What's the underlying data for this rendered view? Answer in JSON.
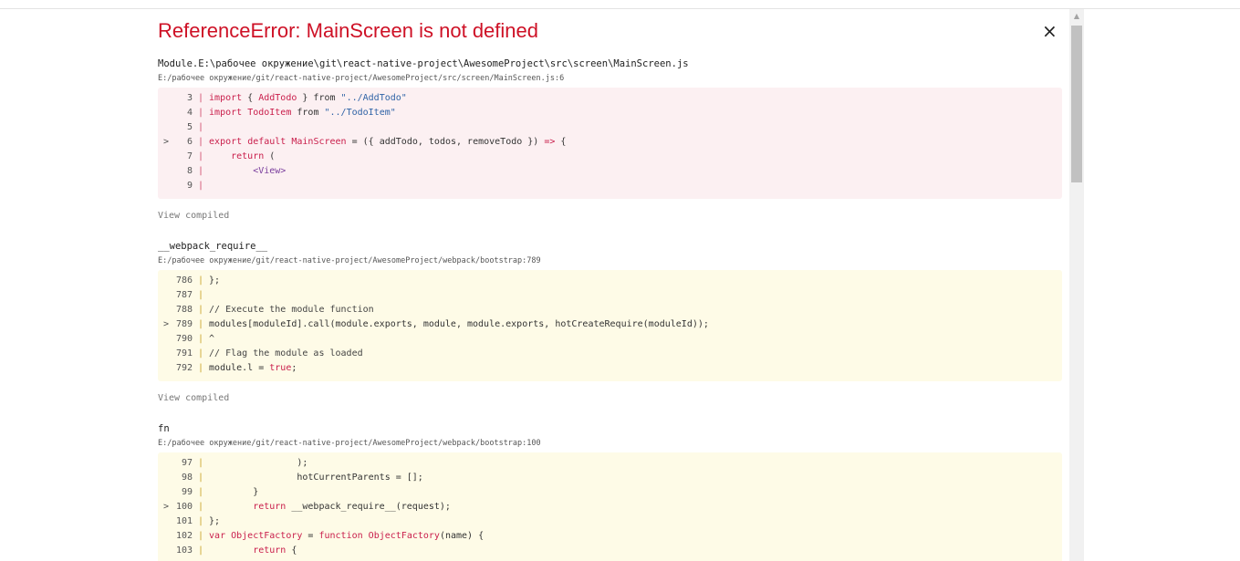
{
  "error": {
    "title": "ReferenceError: MainScreen is not defined",
    "close_glyph": "×"
  },
  "frames": [
    {
      "name": "Module.E:\\рабочее окружение\\git\\react-native-project\\AwesomeProject\\src\\screen\\MainScreen.js",
      "path": "E:/рабочее окружение/git/react-native-project/AwesomeProject/src/screen/MainScreen.js:6",
      "view_compiled": "View compiled"
    },
    {
      "name": "__webpack_require__",
      "path": "E:/рабочее окружение/git/react-native-project/AwesomeProject/webpack/bootstrap:789",
      "view_compiled": "View compiled"
    },
    {
      "name": "fn",
      "path": "E:/рабочее окружение/git/react-native-project/AwesomeProject/webpack/bootstrap:100"
    }
  ],
  "colors": {
    "error_title": "#ce1126",
    "app_code_bg": "#fcf0f2",
    "lib_code_bg": "#fefbe7",
    "keyword": "#c91e4b",
    "string": "#2f63a6"
  },
  "icons": {
    "close": "close-icon",
    "scroll_up": "triangle-up-icon"
  },
  "scroll_up_glyph": "▲"
}
